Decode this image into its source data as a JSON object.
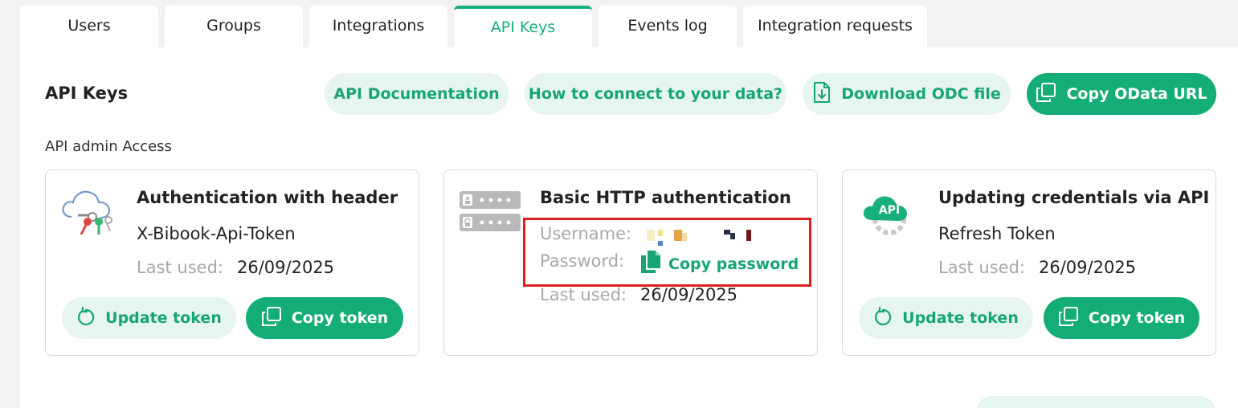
{
  "tabs": [
    {
      "label": "Users"
    },
    {
      "label": "Groups"
    },
    {
      "label": "Integrations"
    },
    {
      "label": "API Keys",
      "active": true
    },
    {
      "label": "Events log"
    },
    {
      "label": "Integration requests"
    }
  ],
  "header": {
    "title": "API Keys",
    "buttons": {
      "api_docs": "API Documentation",
      "how_to_connect": "How to connect to your data?",
      "download_odc": "Download ODC file",
      "copy_odata": "Copy OData URL"
    }
  },
  "section_label": "API admin Access",
  "cards": {
    "header_auth": {
      "title": "Authentication with header",
      "subtitle": "X-Bibook-Api-Token",
      "last_used_label": "Last used:",
      "last_used_value": "26/09/2025",
      "update_label": "Update token",
      "copy_label": "Copy token"
    },
    "basic_auth": {
      "title": "Basic HTTP authentication",
      "username_label": "Username:",
      "password_label": "Password:",
      "copy_password_label": "Copy password",
      "last_used_label": "Last used:",
      "last_used_value": "26/09/2025"
    },
    "api_credentials": {
      "title": "Updating credentials via API",
      "subtitle": "Refresh Token",
      "last_used_label": "Last used:",
      "last_used_value": "26/09/2025",
      "update_label": "Update token",
      "copy_label": "Copy token"
    }
  },
  "colors": {
    "accent": "#17b07a",
    "accent_light": "#e6f5ef",
    "highlight": "#e01e1e"
  }
}
